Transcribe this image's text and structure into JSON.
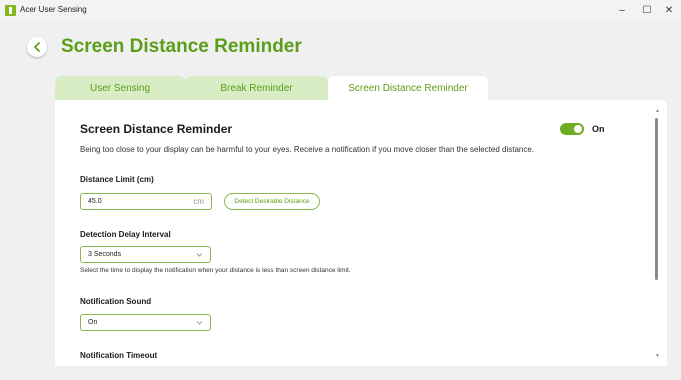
{
  "window": {
    "title": "Acer User Sensing",
    "minimize": "–",
    "maximize": "☐",
    "close": "✕"
  },
  "header": {
    "title": "Screen Distance Reminder"
  },
  "tabs": [
    {
      "label": "User Sensing",
      "active": false
    },
    {
      "label": "Break Reminder",
      "active": false
    },
    {
      "label": "Screen Distance Reminder",
      "active": true
    }
  ],
  "section": {
    "title": "Screen Distance Reminder",
    "toggle_label": "On",
    "toggle_on": true,
    "description": "Being too close to your display can be harmful to your eyes. Receive a notification if you move closer than the selected distance."
  },
  "distance": {
    "label": "Distance Limit (cm)",
    "value": "45.0",
    "unit": "cm",
    "detect_button": "Detect Desirable Distance"
  },
  "delay": {
    "label": "Detection Delay Interval",
    "value": "3 Seconds",
    "hint": "Select the time to display the notification when your distance is less than screen distance limit."
  },
  "sound": {
    "label": "Notification Sound",
    "value": "On"
  },
  "timeout": {
    "label": "Notification Timeout"
  },
  "colors": {
    "accent": "#5a9e19",
    "toggle": "#6fab25",
    "tab_inactive": "#d8edc4"
  }
}
